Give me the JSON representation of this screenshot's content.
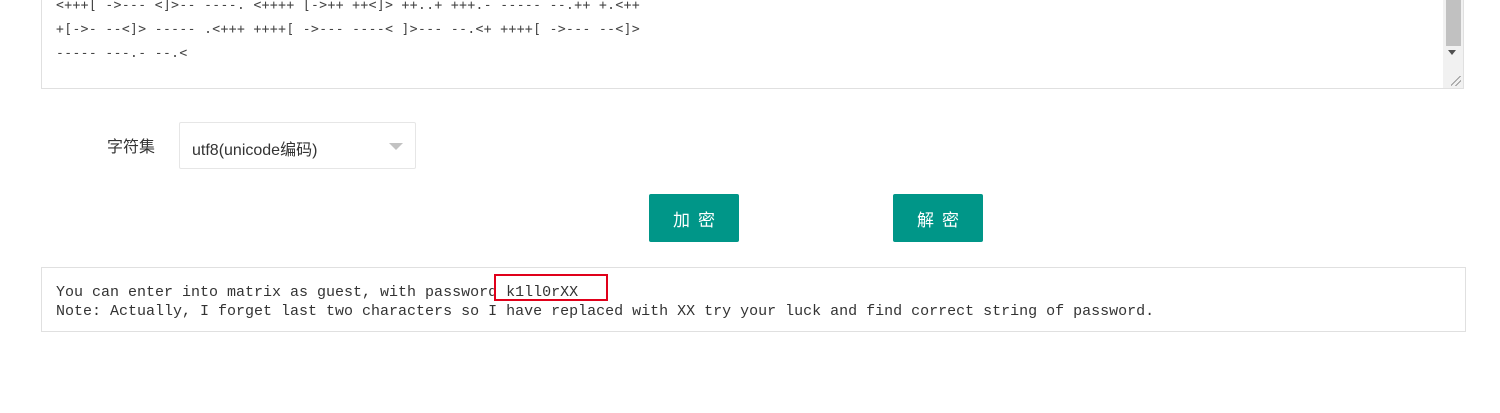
{
  "source": {
    "lines": [
      "<+++[ ->--- <]>-- ----. <++++ [->++ ++<]> ++..+ +++.- ----- --.++ +.<++",
      "+[->- --<]> ----- .<+++ ++++[ ->--- ----< ]>--- --.<+ ++++[ ->--- --<]>",
      "----- ---.- --.<"
    ]
  },
  "charset": {
    "label": "字符集",
    "selected": "utf8(unicode编码)"
  },
  "buttons": {
    "encrypt": "加密",
    "decrypt": "解密"
  },
  "output": {
    "line1": "You can enter into matrix as guest, with password k1ll0rXX",
    "line2": "Note: Actually, I forget last two characters so I have replaced with XX try your luck and find correct string of password."
  },
  "colors": {
    "button": "#009688",
    "highlight": "#e0001a"
  }
}
